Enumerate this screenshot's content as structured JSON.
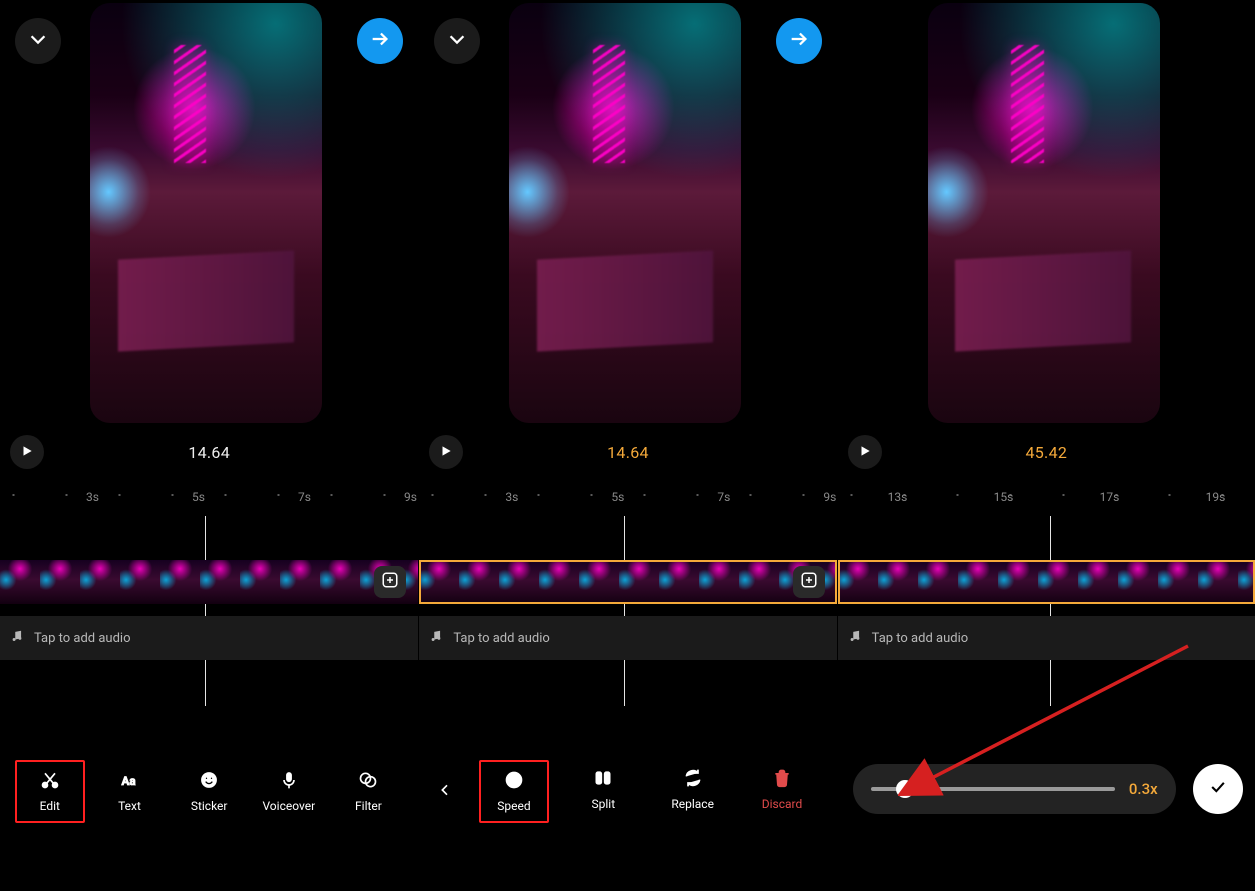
{
  "panels": [
    {
      "timecode": "14.64",
      "timecode_style": "white",
      "ruler_labels": [
        "3s",
        "5s",
        "7s",
        "9s"
      ],
      "selected": false,
      "audio_hint": "Tap to add audio",
      "toolbar_style": "main",
      "tools": [
        {
          "id": "edit",
          "label": "Edit"
        },
        {
          "id": "text",
          "label": "Text"
        },
        {
          "id": "sticker",
          "label": "Sticker"
        },
        {
          "id": "voiceover",
          "label": "Voiceover"
        },
        {
          "id": "filter",
          "label": "Filter"
        }
      ],
      "highlight_tool": "edit",
      "show_top_buttons": true,
      "show_addclip": true
    },
    {
      "timecode": "14.64",
      "timecode_style": "amber",
      "ruler_labels": [
        "3s",
        "5s",
        "7s",
        "9s"
      ],
      "selected": true,
      "audio_hint": "Tap to add audio",
      "toolbar_style": "clip",
      "tools": [
        {
          "id": "speed",
          "label": "Speed"
        },
        {
          "id": "split",
          "label": "Split"
        },
        {
          "id": "replace",
          "label": "Replace"
        },
        {
          "id": "discard",
          "label": "Discard"
        }
      ],
      "highlight_tool": "speed",
      "show_top_buttons": true,
      "show_addclip": true
    },
    {
      "timecode": "45.42",
      "timecode_style": "amber",
      "ruler_labels": [
        "13s",
        "15s",
        "17s",
        "19s"
      ],
      "selected": true,
      "audio_hint": "Tap to add audio",
      "toolbar_style": "speed",
      "speed_value": "0.3x",
      "show_top_buttons": false,
      "show_addclip": false
    }
  ]
}
